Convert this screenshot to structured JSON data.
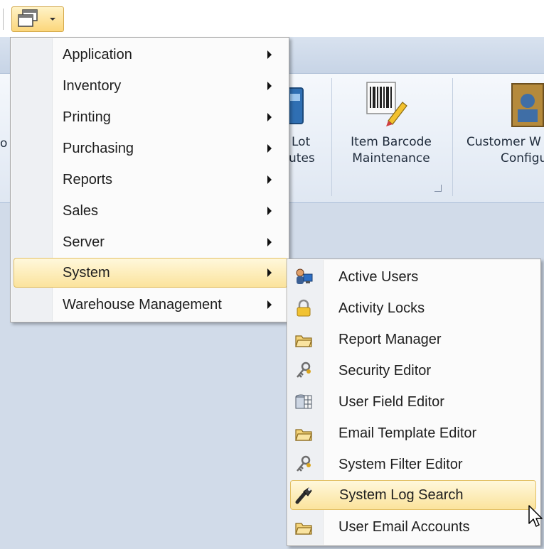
{
  "ribbon": {
    "partial_left": "o",
    "lot_label_1": "Lot",
    "lot_label_2": "utes",
    "item_barcode_label_1": "Item Barcode",
    "item_barcode_label_2": "Maintenance",
    "customer_label_1": "Customer W",
    "customer_label_2": "Configu"
  },
  "main_menu": {
    "items": [
      {
        "label": "Application"
      },
      {
        "label": "Inventory"
      },
      {
        "label": "Printing"
      },
      {
        "label": "Purchasing"
      },
      {
        "label": "Reports"
      },
      {
        "label": "Sales"
      },
      {
        "label": "Server"
      },
      {
        "label": "System"
      },
      {
        "label": "Warehouse Management"
      }
    ],
    "highlighted": "System"
  },
  "system_submenu": {
    "items": [
      {
        "label": "Active Users",
        "icon": "active-users-icon"
      },
      {
        "label": "Activity Locks",
        "icon": "padlock-icon"
      },
      {
        "label": "Report Manager",
        "icon": "folder-icon"
      },
      {
        "label": "Security Editor",
        "icon": "keys-icon"
      },
      {
        "label": "User Field Editor",
        "icon": "database-grid-icon"
      },
      {
        "label": "Email Template Editor",
        "icon": "folder-icon"
      },
      {
        "label": "System Filter Editor",
        "icon": "keys-icon"
      },
      {
        "label": "System Log Search",
        "icon": "flashlight-icon"
      },
      {
        "label": "User Email Accounts",
        "icon": "folder-icon"
      }
    ],
    "highlighted": "System Log Search"
  },
  "colors": {
    "highlight_top": "#fff8dc",
    "highlight_bottom": "#fbe39c",
    "highlight_border": "#e2bf63",
    "ribbon_bg": "#e9eff7",
    "workspace_bg": "#d1dbe9"
  }
}
